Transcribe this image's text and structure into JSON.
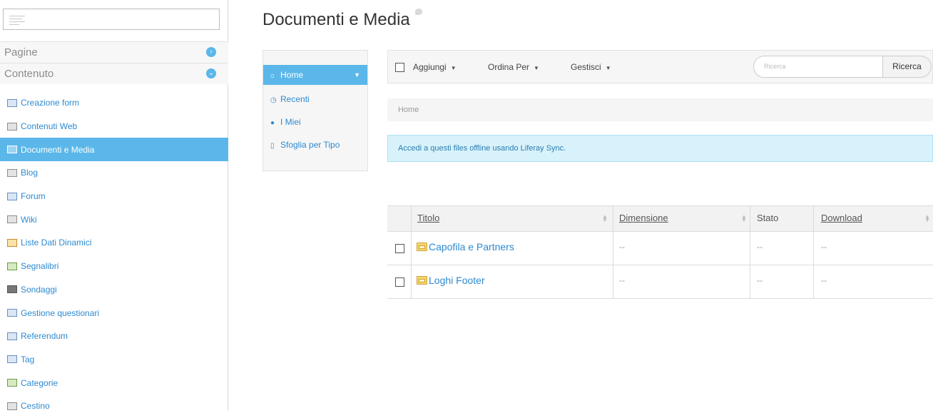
{
  "sidebar": {
    "search_placeholder": "",
    "panels": [
      {
        "label": "Pagine",
        "chevron": "›"
      },
      {
        "label": "Contenuto",
        "chevron": "⌄"
      }
    ],
    "items": [
      {
        "label": "Creazione form",
        "icon": "form-icon"
      },
      {
        "label": "Contenuti Web",
        "icon": "web-content-icon"
      },
      {
        "label": "Documenti e Media",
        "icon": "documents-media-icon"
      },
      {
        "label": "Blog",
        "icon": "blog-icon"
      },
      {
        "label": "Forum",
        "icon": "forum-icon"
      },
      {
        "label": "Wiki",
        "icon": "wiki-icon"
      },
      {
        "label": "Liste Dati Dinamici",
        "icon": "dynamic-lists-icon"
      },
      {
        "label": "Segnalibri",
        "icon": "bookmarks-icon"
      },
      {
        "label": "Sondaggi",
        "icon": "polls-icon"
      },
      {
        "label": "Gestione questionari",
        "icon": "surveys-icon"
      },
      {
        "label": "Referendum",
        "icon": "referendum-icon"
      },
      {
        "label": "Tag",
        "icon": "tag-icon"
      },
      {
        "label": "Categorie",
        "icon": "categories-icon"
      },
      {
        "label": "Cestino",
        "icon": "recycle-bin-icon"
      }
    ],
    "active_index": 2
  },
  "main": {
    "title": "Documenti e Media",
    "left_nav": [
      {
        "label": "Home",
        "icon": "home-icon"
      },
      {
        "label": "Recenti",
        "icon": "clock-icon"
      },
      {
        "label": "I Miei",
        "icon": "user-icon"
      },
      {
        "label": "Sfoglia per Tipo",
        "icon": "file-icon"
      }
    ],
    "toolbar": {
      "add": "Aggiungi",
      "sort": "Ordina Per",
      "manage": "Gestisci",
      "search_placeholder": "Ricerca",
      "search_button": "Ricerca"
    },
    "breadcrumb": "Home",
    "alert": "Accedi a questi files offline usando Liferay Sync.",
    "table": {
      "headers": [
        "Titolo",
        "Dimensione",
        "Stato",
        "Download"
      ],
      "rows": [
        {
          "title": "Capofila e Partners",
          "size": "--",
          "status": "--",
          "download": "--"
        },
        {
          "title": "Loghi Footer",
          "size": "--",
          "status": "--",
          "download": "--"
        }
      ]
    }
  },
  "colors": {
    "accent": "#5bb7e9",
    "link": "#2e8ad0",
    "alert_bg": "#d8f2fb"
  }
}
